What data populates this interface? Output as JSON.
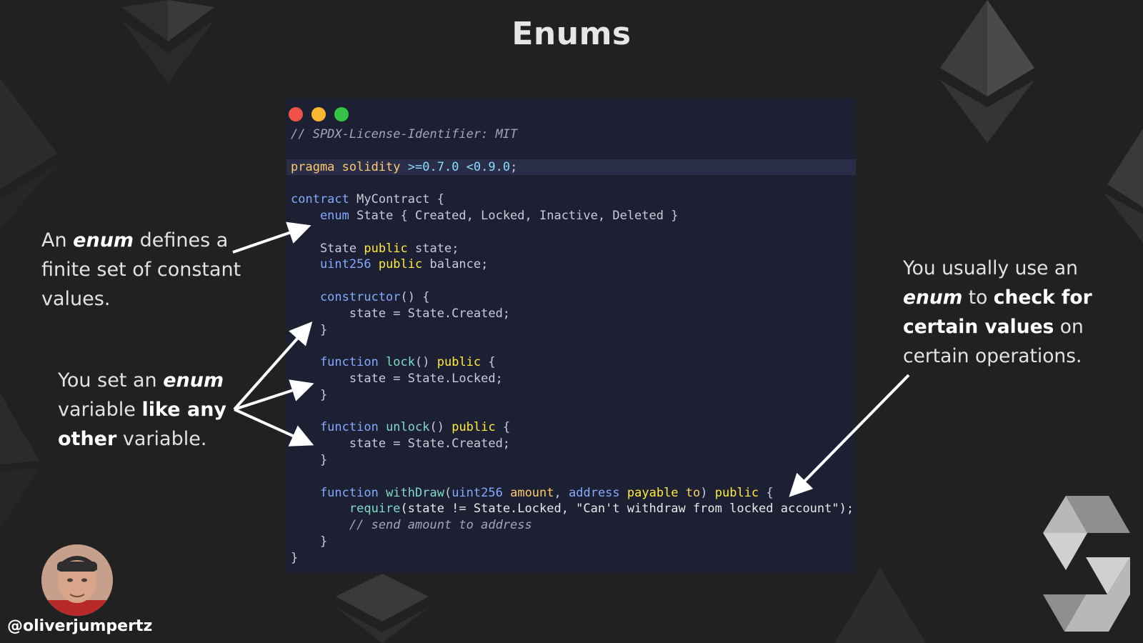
{
  "slide": {
    "title": "Enums"
  },
  "window": {
    "buttons": [
      "close",
      "minimize",
      "maximize"
    ]
  },
  "code": {
    "l1_comment": "// SPDX-License-Identifier: MIT",
    "l2_pragma": "pragma solidity",
    "l2_version": ">=0.7.0 <0.9.0",
    "l2_semi": ";",
    "l3_contract_kw": "contract",
    "l3_contract_name": " MyContract {",
    "l4_enum_kw": "    enum",
    "l4_enum_body": " State { Created, Locked, Inactive, Deleted }",
    "l5_type": "    State ",
    "l5_public": "public",
    "l5_rest": " state;",
    "l6_type": "    uint256",
    "l6_public": " public",
    "l6_rest": " balance;",
    "l7_ctor": "    constructor",
    "l7_rest": "() {",
    "l8": "        state = State.Created;",
    "l9": "    }",
    "l10_fn_kw": "    function",
    "l10_fn_name": " lock",
    "l10_parens": "() ",
    "l10_public": "public",
    "l10_brace": " {",
    "l11": "        state = State.Locked;",
    "l12": "    }",
    "l13_fn_kw": "    function",
    "l13_fn_name": " unlock",
    "l13_parens": "() ",
    "l13_public": "public",
    "l13_brace": " {",
    "l14": "        state = State.Created;",
    "l15": "    }",
    "l16_fn_kw": "    function",
    "l16_fn_name": " withDraw",
    "l16_p1": "(",
    "l16_uint": "uint256",
    "l16_amount": " amount",
    "l16_comma": ", ",
    "l16_address": "address",
    "l16_payable": " payable",
    "l16_to": " to",
    "l16_close": ") ",
    "l16_public": "public",
    "l16_brace": " {",
    "l17_require": "        require",
    "l17_rest": "(state != State.Locked, \"Can't withdraw from locked account\");",
    "l18_comment": "        // send amount to address",
    "l19": "    }",
    "l20": "}"
  },
  "annotations": {
    "a1_p1": "An ",
    "a1_em": "enum",
    "a1_p2": " defines a finite set of constant values.",
    "a2_p1": "You set an ",
    "a2_em": "enum",
    "a2_p2": " variable ",
    "a2_b": "like any other",
    "a2_p3": " variable.",
    "a3_p1": "You usually use an ",
    "a3_em": "enum",
    "a3_p2": " to ",
    "a3_b": "check for certain values",
    "a3_p3": " on certain operations."
  },
  "author": {
    "handle": "@oliverjumpertz"
  },
  "icons": [
    "ethereum-diamond-icon",
    "solidity-logo-icon",
    "avatar-photo"
  ],
  "colors": {
    "background": "#212121",
    "code_bg": "#1d1f33",
    "traffic_red": "#f2514b",
    "traffic_yellow": "#f7b730",
    "traffic_green": "#33c448"
  }
}
